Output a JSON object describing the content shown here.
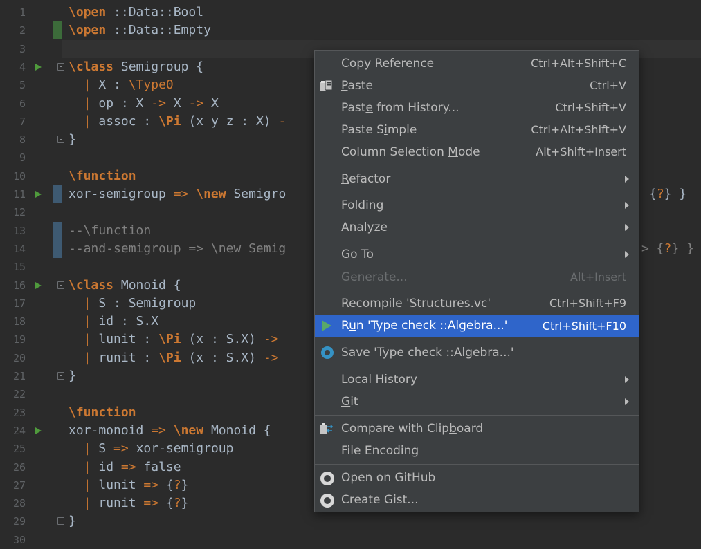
{
  "editor": {
    "lines": [
      {
        "n": "1",
        "gutter": "",
        "code": [
          [
            "kw",
            "\\open"
          ],
          [
            "id",
            " ::Data::Bool"
          ]
        ]
      },
      {
        "n": "2",
        "gutter": "green",
        "code": [
          [
            "kw",
            "\\open"
          ],
          [
            "id",
            " ::Data::Empty"
          ]
        ]
      },
      {
        "n": "3",
        "gutter": "",
        "code": []
      },
      {
        "n": "4",
        "gutter": "run-fold",
        "code": [
          [
            "kw",
            "\\class"
          ],
          [
            "id",
            " Semigroup {"
          ]
        ]
      },
      {
        "n": "5",
        "gutter": "",
        "code": [
          [
            "id",
            "  "
          ],
          [
            "op",
            "|"
          ],
          [
            "id",
            " X : "
          ],
          [
            "ty",
            "\\Type0"
          ]
        ]
      },
      {
        "n": "6",
        "gutter": "",
        "code": [
          [
            "id",
            "  "
          ],
          [
            "op",
            "|"
          ],
          [
            "id",
            " op : X "
          ],
          [
            "op",
            "->"
          ],
          [
            "id",
            " X "
          ],
          [
            "op",
            "->"
          ],
          [
            "id",
            " X"
          ]
        ]
      },
      {
        "n": "7",
        "gutter": "",
        "code": [
          [
            "id",
            "  "
          ],
          [
            "op",
            "|"
          ],
          [
            "id",
            " assoc : "
          ],
          [
            "kw",
            "\\Pi"
          ],
          [
            "id",
            " (x y z : X) "
          ],
          [
            "op",
            "-"
          ]
        ]
      },
      {
        "n": "8",
        "gutter": "fold",
        "code": [
          [
            "id",
            "}"
          ]
        ]
      },
      {
        "n": "9",
        "gutter": "",
        "code": []
      },
      {
        "n": "10",
        "gutter": "",
        "code": [
          [
            "kw",
            "\\function"
          ]
        ]
      },
      {
        "n": "11",
        "gutter": "run-marker",
        "code": [
          [
            "id",
            "xor-semigroup "
          ],
          [
            "op",
            "=>"
          ],
          [
            "id",
            " "
          ],
          [
            "kw",
            "\\new"
          ],
          [
            "id",
            " Semigro"
          ]
        ],
        "tail": "{?} }"
      },
      {
        "n": "12",
        "gutter": "",
        "code": []
      },
      {
        "n": "13",
        "gutter": "marker",
        "code": [
          [
            "cm",
            "--\\function"
          ]
        ]
      },
      {
        "n": "14",
        "gutter": "marker",
        "code": [
          [
            "cm",
            "--and-semigroup => \\new Semig"
          ]
        ],
        "tail": "> {?} }"
      },
      {
        "n": "15",
        "gutter": "",
        "code": []
      },
      {
        "n": "16",
        "gutter": "run-fold",
        "code": [
          [
            "kw",
            "\\class"
          ],
          [
            "id",
            " Monoid {"
          ]
        ]
      },
      {
        "n": "17",
        "gutter": "",
        "code": [
          [
            "id",
            "  "
          ],
          [
            "op",
            "|"
          ],
          [
            "id",
            " S : Semigroup"
          ]
        ]
      },
      {
        "n": "18",
        "gutter": "",
        "code": [
          [
            "id",
            "  "
          ],
          [
            "op",
            "|"
          ],
          [
            "id",
            " id : S.X"
          ]
        ]
      },
      {
        "n": "19",
        "gutter": "",
        "code": [
          [
            "id",
            "  "
          ],
          [
            "op",
            "|"
          ],
          [
            "id",
            " lunit : "
          ],
          [
            "kw",
            "\\Pi"
          ],
          [
            "id",
            " (x : S.X) "
          ],
          [
            "op",
            "->"
          ]
        ]
      },
      {
        "n": "20",
        "gutter": "",
        "code": [
          [
            "id",
            "  "
          ],
          [
            "op",
            "|"
          ],
          [
            "id",
            " runit : "
          ],
          [
            "kw",
            "\\Pi"
          ],
          [
            "id",
            " (x : S.X) "
          ],
          [
            "op",
            "->"
          ]
        ]
      },
      {
        "n": "21",
        "gutter": "fold",
        "code": [
          [
            "id",
            "}"
          ]
        ]
      },
      {
        "n": "22",
        "gutter": "",
        "code": []
      },
      {
        "n": "23",
        "gutter": "",
        "code": [
          [
            "kw",
            "\\function"
          ]
        ]
      },
      {
        "n": "24",
        "gutter": "run",
        "code": [
          [
            "id",
            "xor-monoid "
          ],
          [
            "op",
            "=>"
          ],
          [
            "id",
            " "
          ],
          [
            "kw",
            "\\new"
          ],
          [
            "id",
            " Monoid {"
          ]
        ]
      },
      {
        "n": "25",
        "gutter": "",
        "code": [
          [
            "id",
            "  "
          ],
          [
            "op",
            "|"
          ],
          [
            "id",
            " S "
          ],
          [
            "op",
            "=>"
          ],
          [
            "id",
            " xor-semigroup"
          ]
        ]
      },
      {
        "n": "26",
        "gutter": "",
        "code": [
          [
            "id",
            "  "
          ],
          [
            "op",
            "|"
          ],
          [
            "id",
            " id "
          ],
          [
            "op",
            "=>"
          ],
          [
            "id",
            " false"
          ]
        ]
      },
      {
        "n": "27",
        "gutter": "",
        "code": [
          [
            "id",
            "  "
          ],
          [
            "op",
            "|"
          ],
          [
            "id",
            " lunit "
          ],
          [
            "op",
            "=>"
          ],
          [
            "id",
            " {?}"
          ]
        ]
      },
      {
        "n": "28",
        "gutter": "",
        "code": [
          [
            "id",
            "  "
          ],
          [
            "op",
            "|"
          ],
          [
            "id",
            " runit "
          ],
          [
            "op",
            "=>"
          ],
          [
            "id",
            " {?}"
          ]
        ]
      },
      {
        "n": "29",
        "gutter": "fold",
        "code": [
          [
            "id",
            "}"
          ]
        ]
      },
      {
        "n": "30",
        "gutter": "",
        "code": []
      }
    ]
  },
  "menu": {
    "copy_reference": {
      "pre": "Cop",
      "u": "y",
      "post": " Reference",
      "shortcut": "Ctrl+Alt+Shift+C"
    },
    "paste": {
      "pre": "",
      "u": "P",
      "post": "aste",
      "shortcut": "Ctrl+V"
    },
    "paste_from_history": {
      "pre": "Past",
      "u": "e",
      "post": " from History...",
      "shortcut": "Ctrl+Shift+V"
    },
    "paste_simple": {
      "pre": "Paste S",
      "u": "i",
      "post": "mple",
      "shortcut": "Ctrl+Alt+Shift+V"
    },
    "column_selection_mode": {
      "pre": "Column Selection ",
      "u": "M",
      "post": "ode",
      "shortcut": "Alt+Shift+Insert"
    },
    "refactor": {
      "pre": "",
      "u": "R",
      "post": "efactor"
    },
    "folding": {
      "pre": "Folding",
      "u": "",
      "post": ""
    },
    "analyze": {
      "pre": "Analy",
      "u": "z",
      "post": "e"
    },
    "go_to": {
      "pre": "Go To",
      "u": "",
      "post": ""
    },
    "generate": {
      "pre": "Generate...",
      "u": "",
      "post": "",
      "shortcut": "Alt+Insert"
    },
    "recompile": {
      "pre": "R",
      "u": "e",
      "post": "compile 'Structures.vc'",
      "shortcut": "Ctrl+Shift+F9"
    },
    "run": {
      "pre": "R",
      "u": "u",
      "post": "n 'Type check ::Algebra...'",
      "shortcut": "Ctrl+Shift+F10"
    },
    "save": {
      "pre": "Save 'Type check ::Algebra...'",
      "u": "",
      "post": ""
    },
    "local_history": {
      "pre": "Local ",
      "u": "H",
      "post": "istory"
    },
    "git": {
      "pre": "",
      "u": "G",
      "post": "it"
    },
    "compare_clipboard": {
      "pre": "Compare with Clip",
      "u": "b",
      "post": "oard"
    },
    "file_encoding": {
      "pre": "File Encoding",
      "u": "",
      "post": ""
    },
    "open_github": {
      "pre": "Open on GitHub",
      "u": "",
      "post": ""
    },
    "create_gist": {
      "pre": "Create Gist...",
      "u": "",
      "post": ""
    }
  }
}
